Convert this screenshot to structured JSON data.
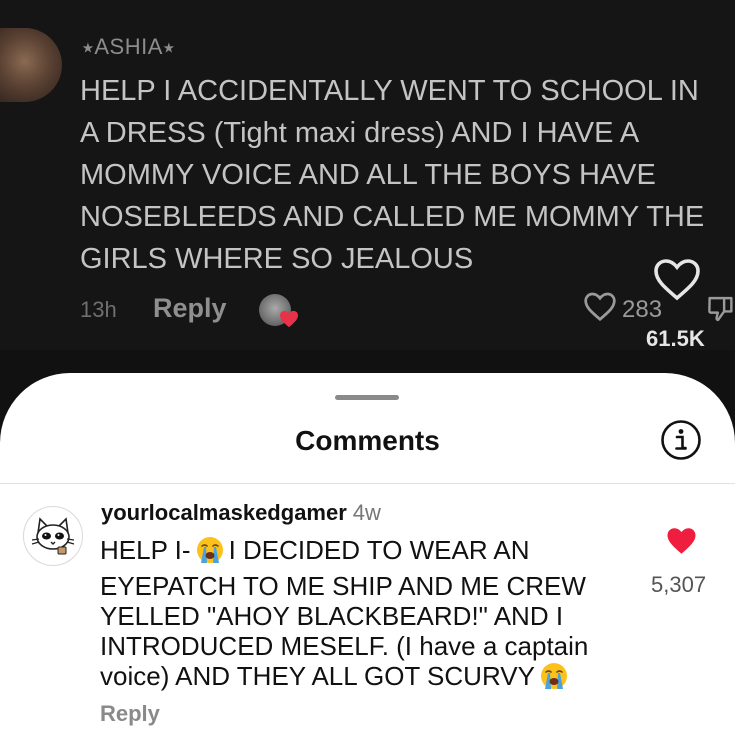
{
  "background_comment": {
    "username": "⭑ASHIA⭑",
    "text": "HELP I ACCIDENTALLY WENT TO SCHOOL IN\nA DRESS (Tight maxi dress) AND I HAVE A\nMOMMY VOICE AND ALL THE BOYS HAVE\nNOSEBLEEDS AND CALLED ME MOMMY THE\nGIRLS WHERE SO JEALOUS",
    "time": "13h",
    "reply_label": "Reply",
    "like_count": "283",
    "total_likes": "61.5K"
  },
  "sheet": {
    "title": "Comments"
  },
  "comment": {
    "username": "yourlocalmaskedgamer",
    "time": "4w",
    "text_part1": "HELP I-",
    "text_part2": "I DECIDED TO WEAR AN\nEYEPATCH TO ME SHIP AND ME CREW\nYELLED \"AHOY BLACKBEARD!\" AND I\nINTRODUCED MESELF. (I have a captain\nvoice) AND THEY ALL GOT SCURVY",
    "emoji": "loudly-crying-face",
    "like_count": "5,307",
    "liked": true,
    "reply_label": "Reply",
    "heart_color": "#ef1d3e"
  }
}
